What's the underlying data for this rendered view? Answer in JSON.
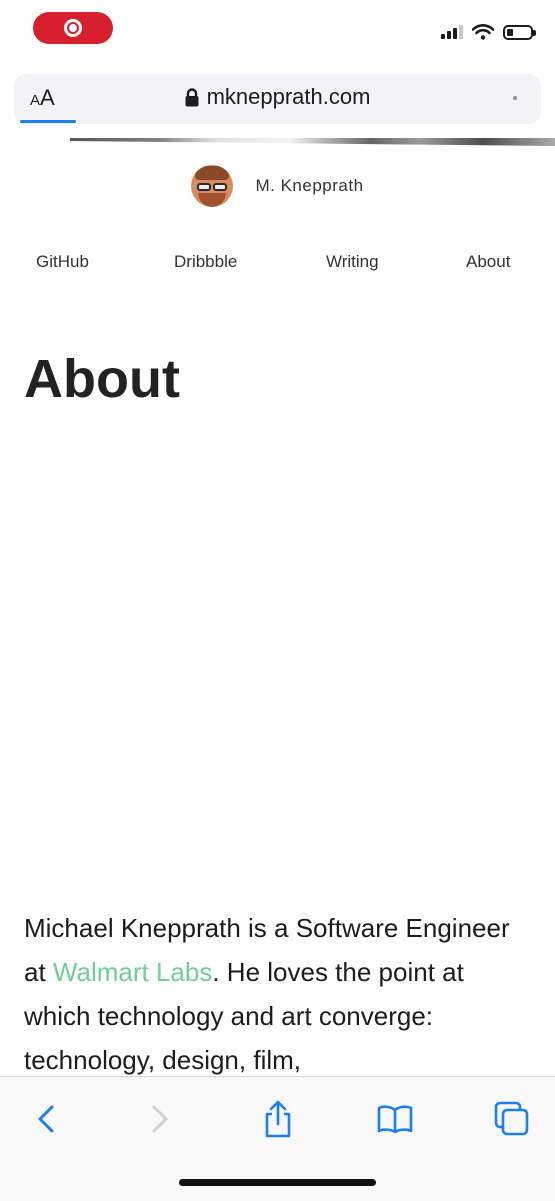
{
  "status_bar": {
    "recording_indicator": "screen-recording",
    "icons": [
      "signal-icon",
      "wifi-icon",
      "battery-icon"
    ]
  },
  "browser": {
    "text_size_label_small": "A",
    "text_size_label_large": "A",
    "url": "mknepprath.com",
    "accent_color": "#1a7ff5"
  },
  "site": {
    "owner_name": "M. Knepprath",
    "nav": [
      "GitHub",
      "Dribbble",
      "Writing",
      "About"
    ],
    "page_title": "About",
    "bio": {
      "before_link": "Michael Knepprath is a Software Engineer at ",
      "link_text": "Walmart Labs",
      "after_link": ". He loves the point at which technology and art converge: technology, design, film,",
      "link_color": "#6fcf97"
    }
  },
  "toolbar": {
    "buttons": [
      "back",
      "forward",
      "share",
      "bookmarks",
      "tabs"
    ]
  }
}
